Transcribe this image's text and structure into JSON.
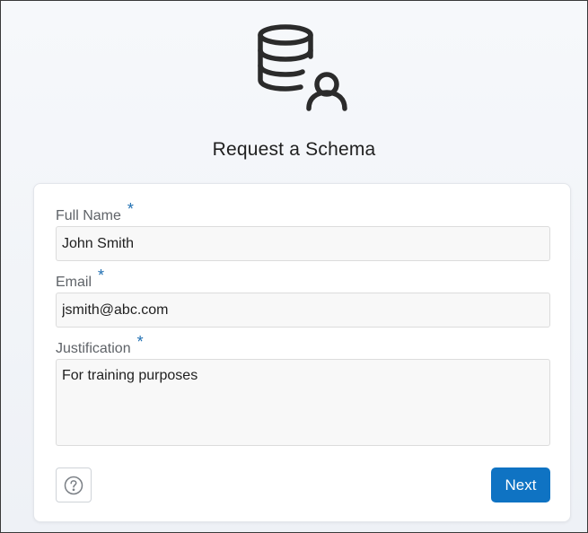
{
  "header": {
    "icon": "database-user-icon",
    "title": "Request a Schema"
  },
  "form": {
    "full_name": {
      "label": "Full Name",
      "required_mark": "*",
      "value": "John Smith"
    },
    "email": {
      "label": "Email",
      "required_mark": "*",
      "value": "jsmith@abc.com"
    },
    "justification": {
      "label": "Justification",
      "required_mark": "*",
      "value": "For training purposes"
    }
  },
  "footer": {
    "help_icon": "question-circle-icon",
    "next_label": "Next"
  },
  "colors": {
    "accent": "#0f73c3",
    "required_mark": "#1f6fb2"
  }
}
